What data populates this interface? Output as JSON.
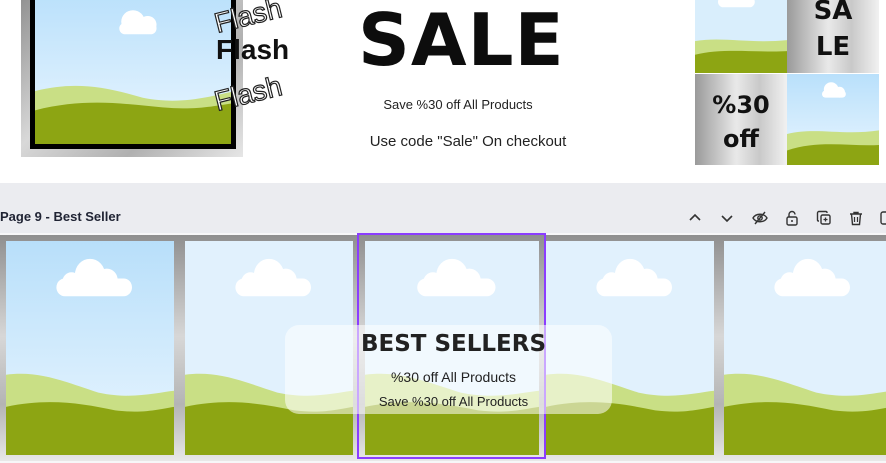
{
  "top_page": {
    "flash_words": [
      "Flash",
      "Flash",
      "Flash"
    ],
    "sale_title": "SALE",
    "sale_subtitle": "Save %30 off All Products",
    "sale_code": "Use code \"Sale\" On checkout",
    "side_text_1a": "SA",
    "side_text_1b": "LE",
    "side_text_2a": "%30",
    "side_text_2b": "off"
  },
  "toolbar": {
    "page_label": "Page 9 - Best Seller",
    "icons": [
      "chevron-up-icon",
      "chevron-down-icon",
      "hide-icon",
      "lock-icon",
      "duplicate-icon",
      "trash-icon",
      "add-page-icon"
    ]
  },
  "bottom_page": {
    "title": "BEST SELLERS",
    "line1": "%30 off All Products",
    "line2": "Save %30 off All Products"
  },
  "colors": {
    "accent": "#8b3dff",
    "sky": "#cfe9fb",
    "grass": "#8da513",
    "grass_light": "#c9df85"
  }
}
